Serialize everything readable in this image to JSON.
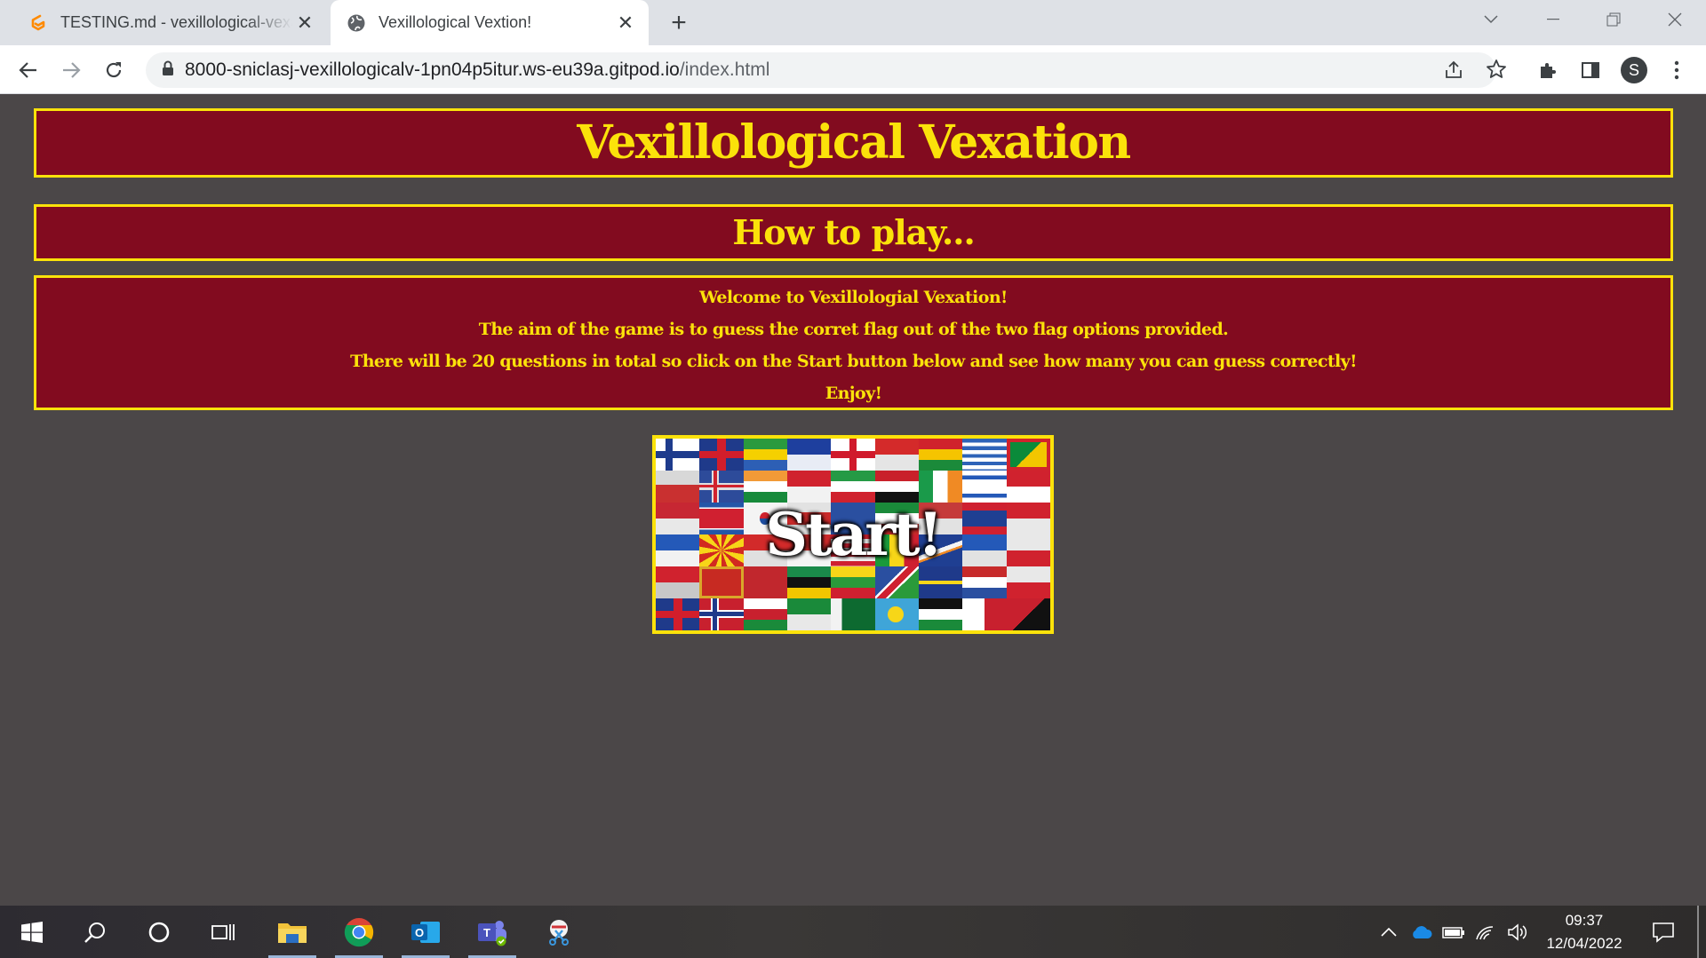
{
  "browser": {
    "tabs": [
      {
        "title": "TESTING.md - vexillological-vexation",
        "favicon": "gitpod-icon",
        "active": false
      },
      {
        "title": "Vexillological Vextion!",
        "favicon": "globe-icon",
        "active": true
      }
    ],
    "url_host": "8000-sniclasj-vexillologicalv-1pn04p5itur.ws-eu39a.gitpod.io",
    "url_path": "/index.html",
    "profile_initial": "S"
  },
  "page": {
    "title": "Vexillological Vexation",
    "how_to_heading": "How to play...",
    "intro_lines": [
      "Welcome to Vexillologial Vexation!",
      "The aim of the game is to guess the corret flag out of the two flag options provided.",
      "There will be 20 questions in total so click on the Start button below and see how many you can guess correctly!",
      "Enjoy!"
    ],
    "start_label": "Start!",
    "colors": {
      "background": "#4b4748",
      "panel": "#820b1f",
      "accent": "#fbe20a"
    }
  },
  "taskbar": {
    "apps": [
      "windows-start-icon",
      "search-icon",
      "cortana-icon",
      "task-view-icon",
      "file-explorer-icon",
      "chrome-icon",
      "outlook-icon",
      "teams-icon",
      "snipping-tool-icon"
    ],
    "clock_time": "09:37",
    "clock_date": "12/04/2022"
  }
}
